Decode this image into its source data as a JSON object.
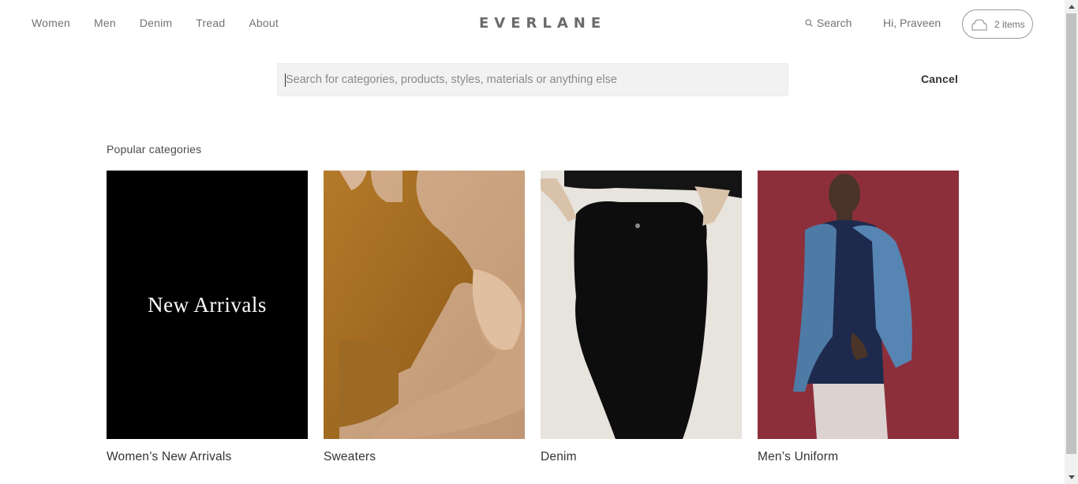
{
  "header": {
    "nav": [
      "Women",
      "Men",
      "Denim",
      "Tread",
      "About"
    ],
    "logo": "EVERLANE",
    "search_label": "Search",
    "greeting": "Hi, Praveen",
    "cart_count": "2 items"
  },
  "search": {
    "placeholder": "Search for categories, products, styles, materials or anything else",
    "value": "",
    "cancel_label": "Cancel"
  },
  "popular": {
    "title": "Popular categories",
    "categories": [
      {
        "label": "Women’s New Arrivals",
        "image_text": "New Arrivals"
      },
      {
        "label": "Sweaters"
      },
      {
        "label": "Denim"
      },
      {
        "label": "Men’s Uniform"
      }
    ]
  },
  "colors": {
    "nav_text": "#737373",
    "new_arrivals_bg": "#000000",
    "sweater_bg": "#c9a27c",
    "denim_bg": "#e7e3dd",
    "mens_bg": "#8c2f3b"
  },
  "icons": [
    "search-icon",
    "cart-icon",
    "scroll-up-icon",
    "scroll-down-icon"
  ]
}
